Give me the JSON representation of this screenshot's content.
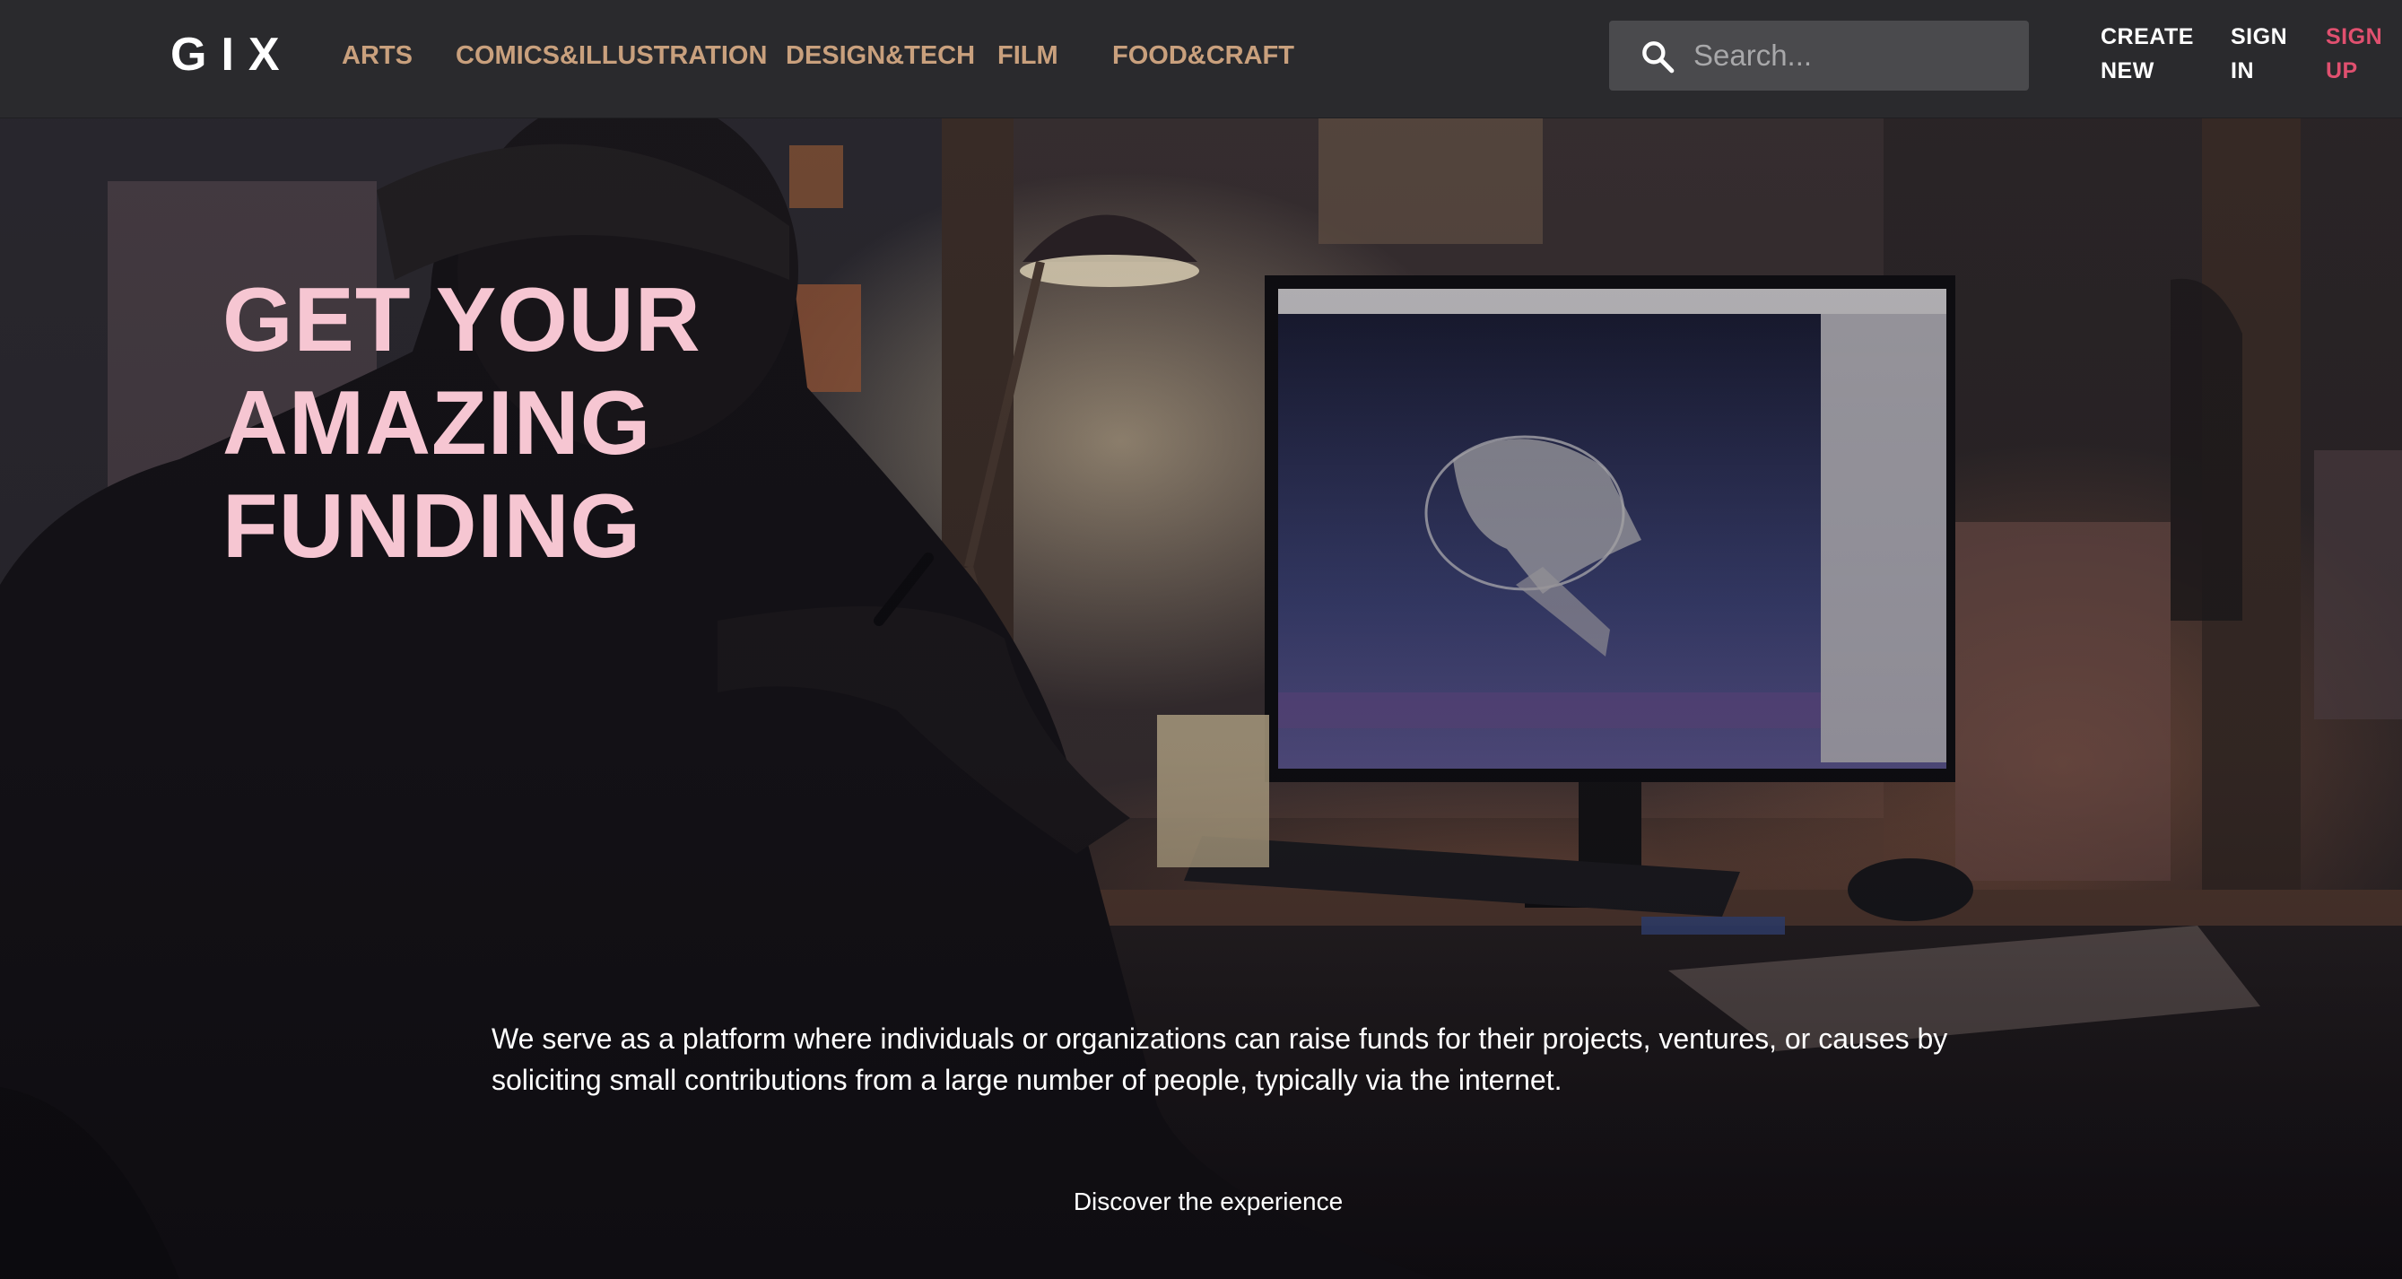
{
  "header": {
    "logo": "GIX",
    "nav": [
      "ARTS",
      "COMICS&ILLUSTRATION",
      "DESIGN&TECH",
      "FILM",
      "FOOD&CRAFT"
    ],
    "search": {
      "placeholder": "Search...",
      "icon": "search-icon"
    },
    "actions": {
      "create": [
        "CREATE",
        "NEW"
      ],
      "signin": [
        "SIGN",
        "IN"
      ],
      "signup": [
        "SIGN",
        "UP"
      ]
    }
  },
  "hero": {
    "headline": [
      "GET YOUR",
      "AMAZING",
      "FUNDING"
    ],
    "description": "We serve as a platform where individuals or organizations can raise funds for their projects, ventures, or causes by soliciting small contributions from a large number of people, typically via the internet.",
    "cta": "Discover the experience"
  },
  "colors": {
    "header_bg": "#2a2a2d",
    "nav_link": "#c9a07d",
    "headline": "#f6c6d2",
    "signup": "#e0506f",
    "search_bg": "#4a4a4d"
  }
}
